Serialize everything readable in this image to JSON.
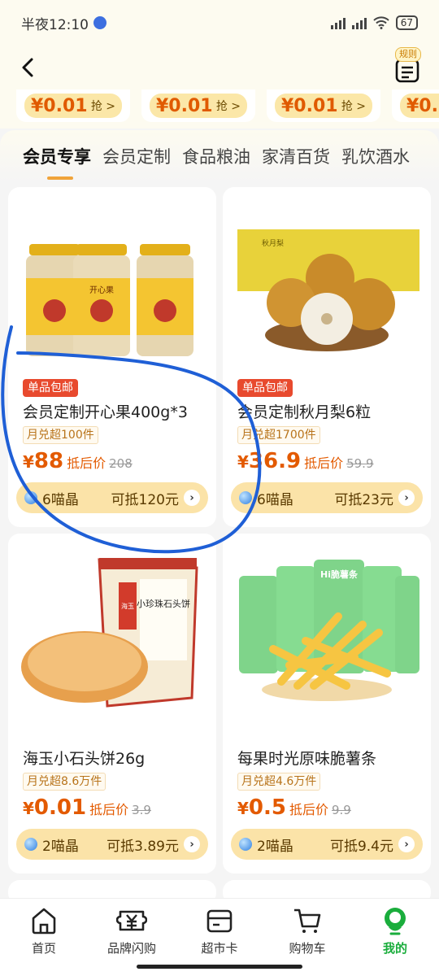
{
  "status_bar": {
    "time": "半夜12:10",
    "battery": "67"
  },
  "header": {
    "rules_badge": "规则"
  },
  "coupons": [
    {
      "price": "¥0.01",
      "grab": "抢 >"
    },
    {
      "price": "¥0.01",
      "grab": "抢 >"
    },
    {
      "price": "¥0.01",
      "grab": "抢 >"
    },
    {
      "price": "¥0.",
      "grab": ""
    }
  ],
  "tabs": [
    "会员专享",
    "会员定制",
    "食品粮油",
    "家清百货",
    "乳饮酒水"
  ],
  "products": [
    {
      "tag": "单品包邮",
      "title": "会员定制开心果400g*3",
      "sold": "月兑超100件",
      "price": "88",
      "after_label": "抵后价",
      "orig": "208",
      "gems": "6喵晶",
      "offset": "可抵120元"
    },
    {
      "tag": "单品包邮",
      "title": "会员定制秋月梨6粒",
      "sold": "月兑超1700件",
      "price": "36.9",
      "after_label": "抵后价",
      "orig": "59.9",
      "gems": "6喵晶",
      "offset": "可抵23元"
    },
    {
      "tag": "",
      "title": "海玉小石头饼26g",
      "sold": "月兑超8.6万件",
      "price": "0.01",
      "after_label": "抵后价",
      "orig": "3.9",
      "gems": "2喵晶",
      "offset": "可抵3.89元"
    },
    {
      "tag": "",
      "title": "每果时光原味脆薯条",
      "sold": "月兑超4.6万件",
      "price": "0.5",
      "after_label": "抵后价",
      "orig": "9.9",
      "gems": "2喵晶",
      "offset": "可抵9.4元"
    }
  ],
  "product_images": [
    {
      "pack_label": "开心果"
    },
    {
      "pack_label": "秋月梨"
    },
    {
      "pack_label": "小珍珠石头饼",
      "pack_brand": "海玉"
    },
    {
      "pack_label": "Hi脆薯条"
    }
  ],
  "nav": [
    {
      "label": "首页"
    },
    {
      "label": "品牌闪购"
    },
    {
      "label": "超市卡"
    },
    {
      "label": "购物车"
    },
    {
      "label": "我的"
    }
  ],
  "colors": {
    "price": "#e35a00",
    "accent": "#f0a43a",
    "active_nav": "#1aad3c",
    "tag": "#e84a2e"
  }
}
